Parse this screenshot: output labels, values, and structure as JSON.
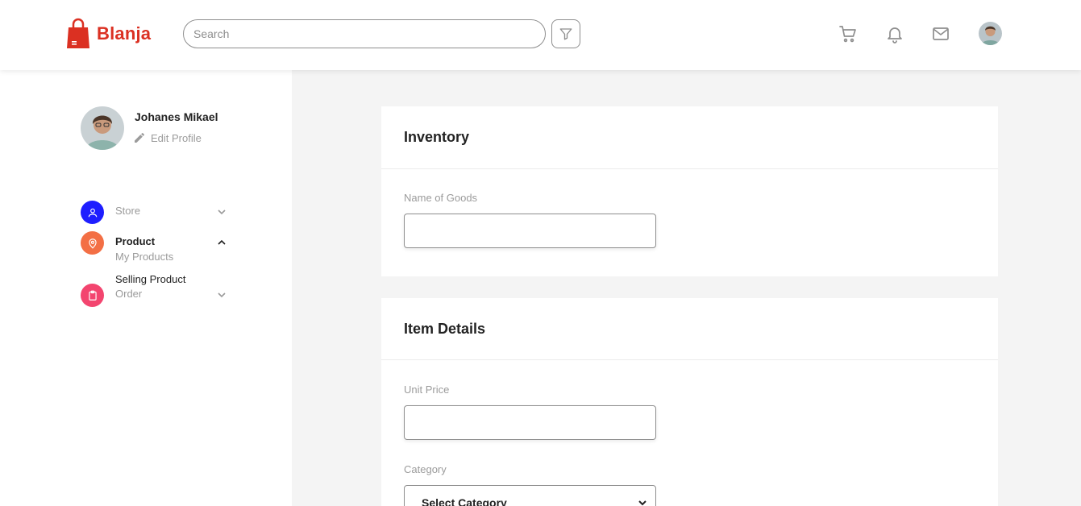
{
  "brand": {
    "name": "Blanja",
    "color": "#db3022"
  },
  "search": {
    "placeholder": "Search"
  },
  "nav_icons": [
    "cart-icon",
    "bell-icon",
    "mail-icon"
  ],
  "user": {
    "name": "Johanes Mikael",
    "edit_label": "Edit Profile"
  },
  "sidebar": {
    "items": [
      {
        "label": "Store",
        "icon": "user-icon",
        "color": "#1e1eff"
      },
      {
        "label": "Product",
        "icon": "pin-icon",
        "color": "#f36f45",
        "subitems": [
          "My Products",
          "Selling Product"
        ]
      },
      {
        "label": "Order",
        "icon": "clipboard-icon",
        "color": "#f3456f"
      }
    ]
  },
  "inventory": {
    "title": "Inventory",
    "name_label": "Name of Goods",
    "name_value": ""
  },
  "item_details": {
    "title": "Item Details",
    "price_label": "Unit Price",
    "price_value": "",
    "category_label": "Category",
    "category_selected": "Select Category"
  }
}
